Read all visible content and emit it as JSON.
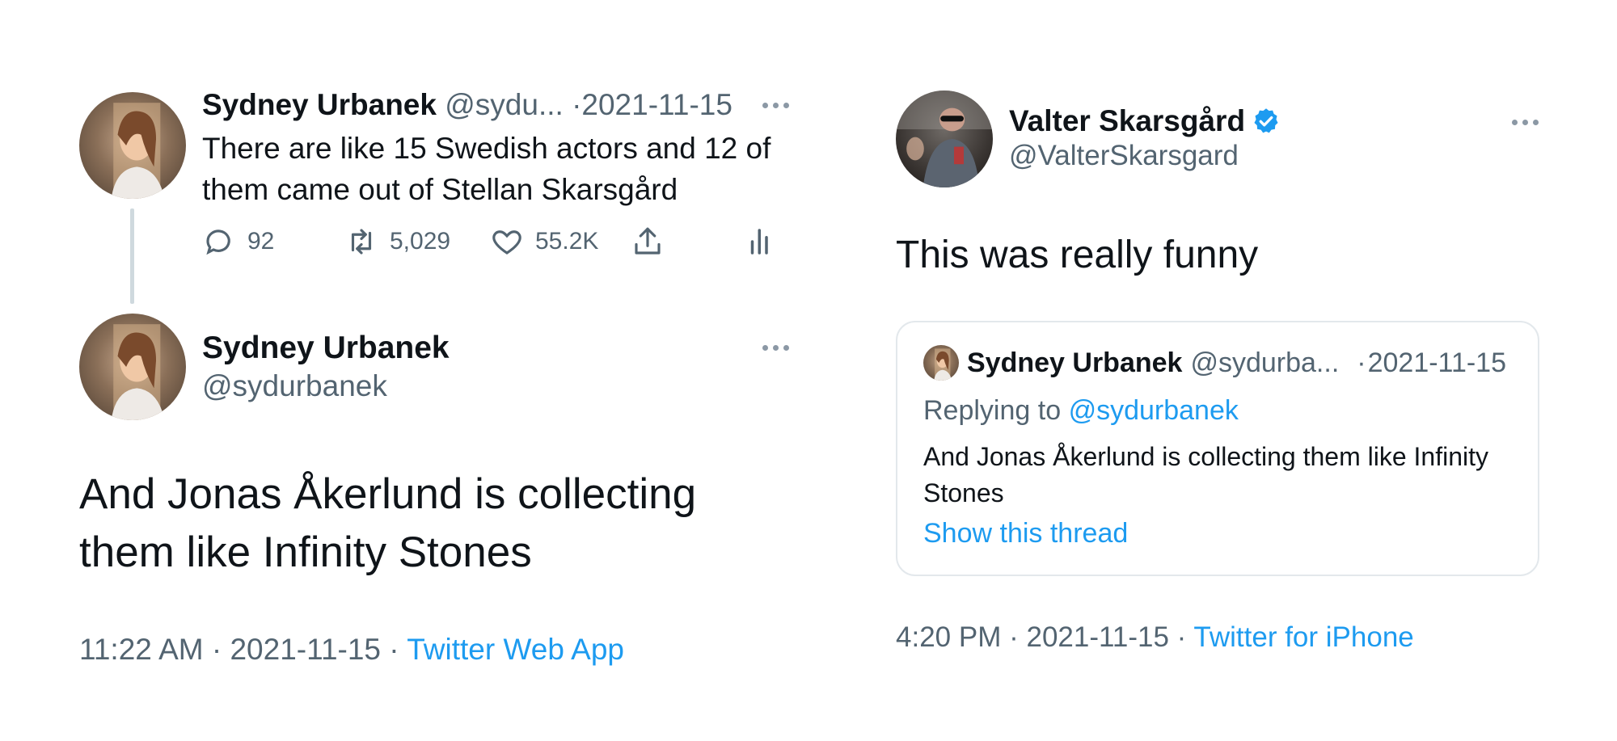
{
  "tweet1": {
    "author_name": "Sydney Urbanek",
    "author_handle": "@sydu...",
    "separator": "·",
    "date": "2021-11-15",
    "text": "There are like 15 Swedish actors and 12 of them came out of Stellan Skarsgård",
    "replies": "92",
    "retweets": "5,029",
    "likes": "55.2K"
  },
  "tweet2": {
    "author_name": "Sydney Urbanek",
    "author_handle": "@sydurbanek",
    "text": "And Jonas Åkerlund is collecting them like Infinity Stones",
    "time": "11:22 AM",
    "separator": "·",
    "date": "2021-11-15",
    "source": "Twitter Web App"
  },
  "tweet3": {
    "author_name": "Valter Skarsgård",
    "author_handle": "@ValterSkarsgard",
    "text": "This was really funny",
    "time": "4:20 PM",
    "separator": "·",
    "date": "2021-11-15",
    "source": "Twitter for iPhone",
    "quote": {
      "author_name": "Sydney Urbanek",
      "author_handle": "@sydurba...",
      "separator": "·",
      "date": "2021-11-15",
      "replying_label": "Replying to",
      "replying_handle": "@sydurbanek",
      "text": "And Jonas Åkerlund is collecting them like Infinity Stones",
      "show_thread": "Show this thread"
    }
  },
  "icons": {
    "reply": "speech-bubble-icon",
    "retweet": "retweet-arrows-icon",
    "like": "heart-icon",
    "share": "share-upload-icon",
    "analytics": "analytics-bars-icon",
    "more": "more-dots-icon",
    "verified": "verified-badge-icon"
  },
  "colors": {
    "text": "#0f1419",
    "muted": "#536471",
    "link": "#1d9bf0",
    "verified": "#1d9bf0",
    "border": "#e3e8ec"
  }
}
